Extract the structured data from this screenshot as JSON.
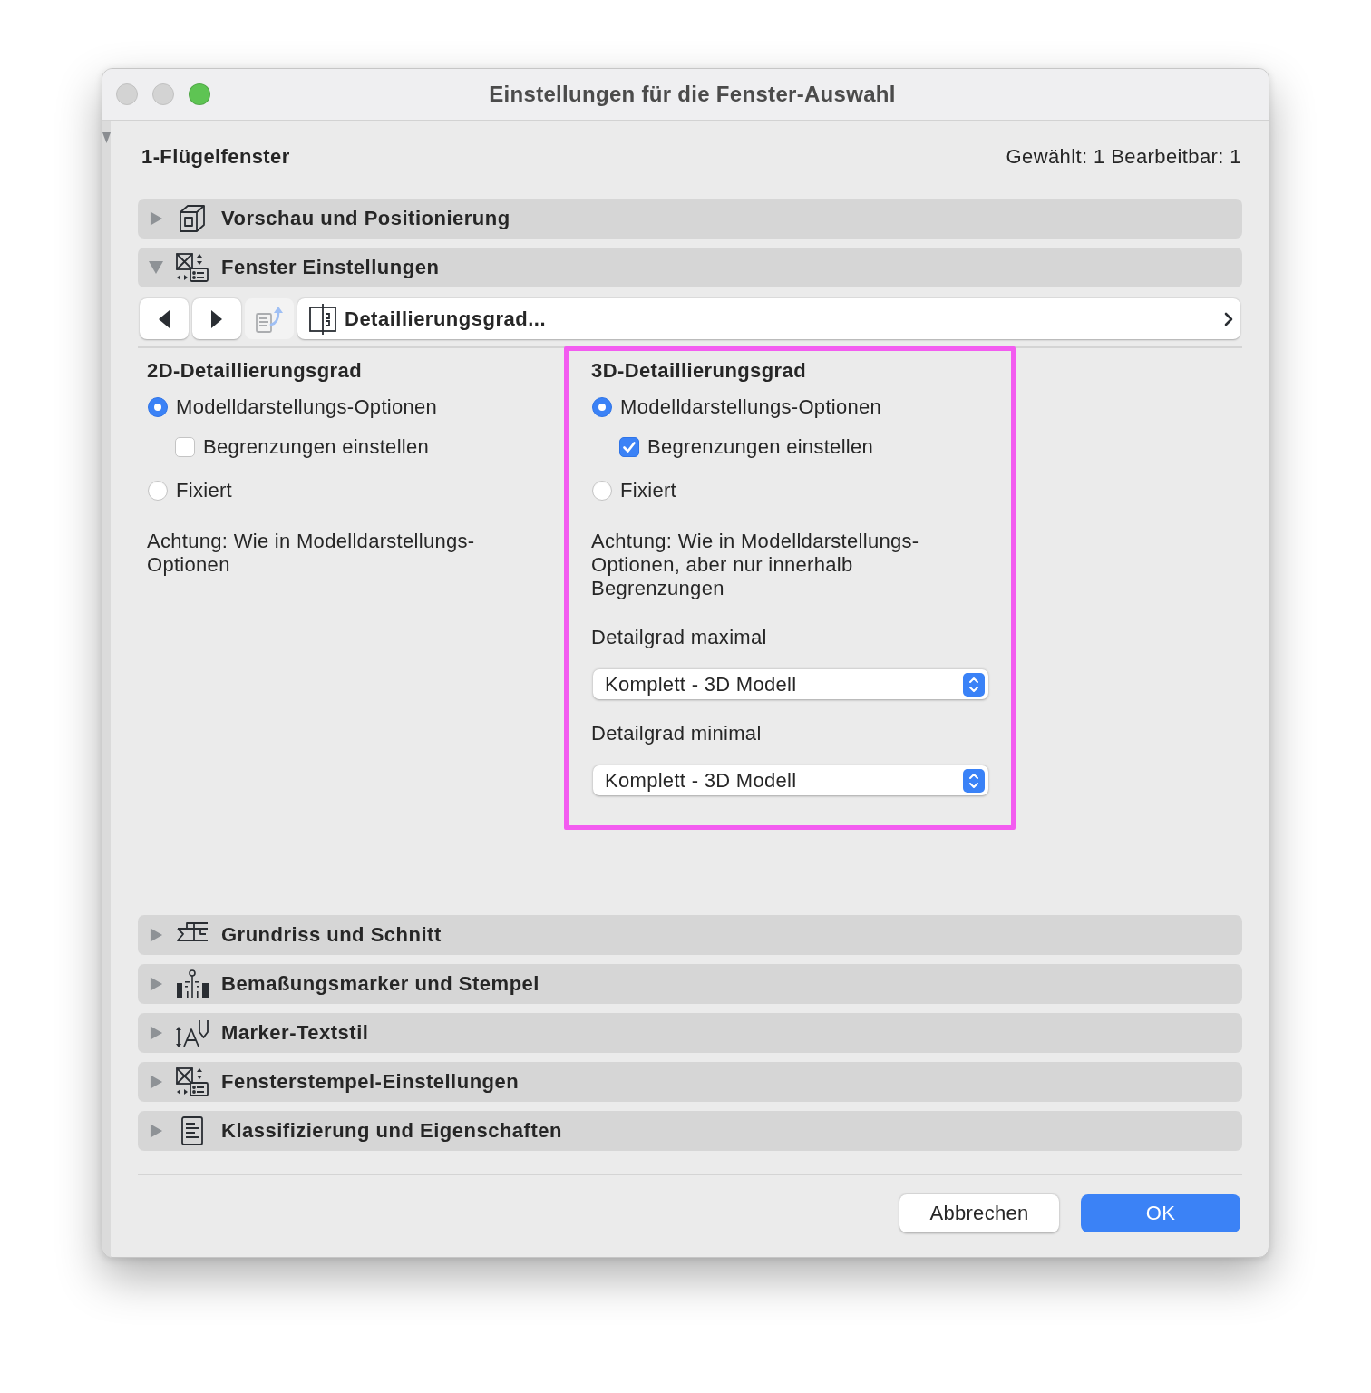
{
  "window": {
    "title": "Einstellungen für die Fenster-Auswahl",
    "controls": [
      {
        "kind": "close",
        "enabled": false
      },
      {
        "kind": "minimize",
        "enabled": false
      },
      {
        "kind": "zoom",
        "enabled": true
      }
    ]
  },
  "header": {
    "element": "1-Flügelfenster",
    "counts": "Gewählt: 1 Bearbeitbar: 1"
  },
  "sections_top": [
    {
      "kind": "preview",
      "label": "Vorschau und Positionierung",
      "expanded": false
    },
    {
      "kind": "window",
      "label": "Fenster Einstellungen",
      "expanded": true
    }
  ],
  "toolbar": {
    "buttons": [
      {
        "kind": "previous",
        "disabled": false
      },
      {
        "kind": "next",
        "disabled": false
      },
      {
        "kind": "export",
        "disabled": true
      }
    ],
    "page": "Detaillierungsgrad..."
  },
  "detail_2d": {
    "heading": "2D-Detaillierungsgrad",
    "options": [
      {
        "label": "Modelldarstellungs-Optionen",
        "selected": true,
        "sub_option": {
          "label": "Begrenzungen einstellen",
          "checked": false
        }
      },
      {
        "label": "Fixiert",
        "selected": false
      }
    ],
    "note": "Achtung: Wie in Modelldarstellungs-Optionen"
  },
  "detail_3d": {
    "heading": "3D-Detaillierungsgrad",
    "highlighted": true,
    "options": [
      {
        "label": "Modelldarstellungs-Optionen",
        "selected": true,
        "sub_option": {
          "label": "Begrenzungen einstellen",
          "checked": true
        }
      },
      {
        "label": "Fixiert",
        "selected": false
      }
    ],
    "note": "Achtung: Wie in Modelldarstellungs-Optionen, aber nur innerhalb Begrenzungen",
    "selects": [
      {
        "label": "Detailgrad maximal",
        "value": "Komplett - 3D Modell"
      },
      {
        "label": "Detailgrad minimal",
        "value": "Komplett - 3D Modell"
      }
    ]
  },
  "sections_bottom": [
    {
      "kind": "plan",
      "label": "Grundriss und Schnitt",
      "expanded": false
    },
    {
      "kind": "dimension",
      "label": "Bemaßungsmarker und Stempel",
      "expanded": false
    },
    {
      "kind": "textstyle",
      "label": "Marker-Textstil",
      "expanded": false
    },
    {
      "kind": "stamp",
      "label": "Fensterstempel-Einstellungen",
      "expanded": false
    },
    {
      "kind": "properties",
      "label": "Klassifizierung und Eigenschaften",
      "expanded": false
    }
  ],
  "buttons": [
    {
      "kind": "cancel",
      "label": "Abbrechen"
    },
    {
      "kind": "default",
      "label": "OK"
    }
  ]
}
